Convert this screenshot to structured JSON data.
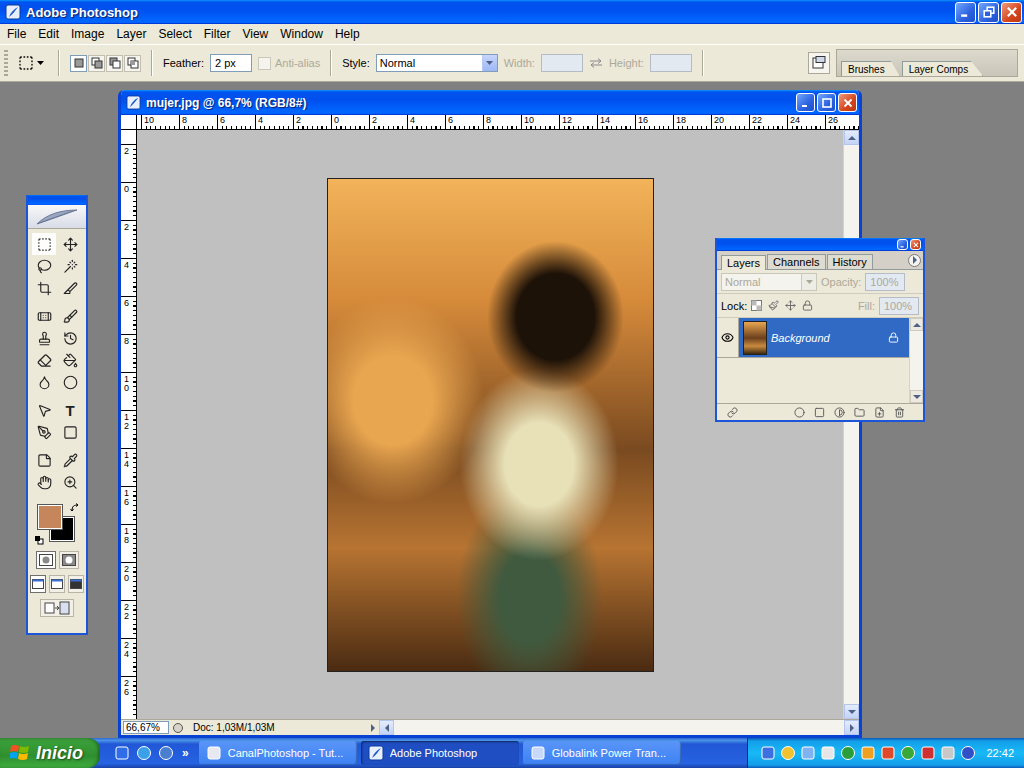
{
  "window": {
    "title": "Adobe Photoshop"
  },
  "menu": [
    "File",
    "Edit",
    "Image",
    "Layer",
    "Select",
    "Filter",
    "View",
    "Window",
    "Help"
  ],
  "options_bar": {
    "selection_modes": [
      {
        "selected": true
      },
      {
        "selected": false
      },
      {
        "selected": false
      },
      {
        "selected": false
      }
    ],
    "feather_label": "Feather:",
    "feather_value": "2 px",
    "anti_alias": {
      "label": "Anti-alias",
      "checked": false,
      "disabled": true
    },
    "style_label": "Style:",
    "style_value": "Normal",
    "width_label": "Width:",
    "height_label": "Height:",
    "size_disabled": true,
    "palette_well": [
      "Brushes",
      "Layer Comps"
    ]
  },
  "document": {
    "title": "mujer.jpg @ 66,7% (RGB/8#)",
    "ruler_top": [
      "10",
      "8",
      "6",
      "4",
      "2",
      "0",
      "2",
      "4",
      "6",
      "8",
      "10",
      "12",
      "14",
      "16",
      "18",
      "20",
      "22",
      "24",
      "26"
    ],
    "ruler_left": [
      "2",
      "0",
      "2",
      "4",
      "6",
      "8",
      "10",
      "12",
      "14",
      "16",
      "18",
      "20",
      "22",
      "24",
      "26"
    ],
    "zoom": "66,67%",
    "doc_info": "Doc: 1,03M/1,03M"
  },
  "toolbox": {
    "tools": [
      {
        "selected": true
      },
      {
        "selected": false
      },
      {
        "selected": false
      },
      {
        "selected": false
      },
      {
        "selected": false
      },
      {
        "selected": false
      },
      {
        "selected": false
      },
      {
        "selected": false
      },
      {
        "selected": false
      },
      {
        "selected": false
      },
      {
        "selected": false
      },
      {
        "selected": false
      },
      {
        "selected": false
      },
      {
        "selected": false
      },
      {
        "selected": false
      },
      {
        "selected": false,
        "glyph": "T"
      },
      {
        "selected": false
      },
      {
        "selected": false
      },
      {
        "selected": false
      },
      {
        "selected": false
      },
      {
        "selected": false
      },
      {
        "selected": false
      }
    ],
    "foreground_color": "#c4865a",
    "background_color": "#000000",
    "quick_mask": [
      {
        "selected": true
      },
      {
        "selected": false
      }
    ],
    "screen_modes": [
      {
        "selected": true
      },
      {
        "selected": false
      },
      {
        "selected": false
      }
    ]
  },
  "layers_panel": {
    "tabs": [
      {
        "label": "Layers",
        "selected": true
      },
      {
        "label": "Channels",
        "selected": false
      },
      {
        "label": "History",
        "selected": false
      }
    ],
    "blend_mode": "Normal",
    "opacity_label": "Opacity:",
    "opacity": "100%",
    "lock_label": "Lock:",
    "fill_label": "Fill:",
    "fill": "100%",
    "controls_disabled": true,
    "layers": [
      {
        "name": "Background",
        "selected": true,
        "visible": true,
        "locked": true
      }
    ]
  },
  "taskbar": {
    "start": "Inicio",
    "chevron": "»",
    "tasks": [
      {
        "label": "CanalPhotoshop - Tut...",
        "selected": false
      },
      {
        "label": "Adobe Photoshop",
        "selected": true
      },
      {
        "label": "Globalink Power Tran...",
        "selected": false
      }
    ],
    "clock": "22:42"
  }
}
